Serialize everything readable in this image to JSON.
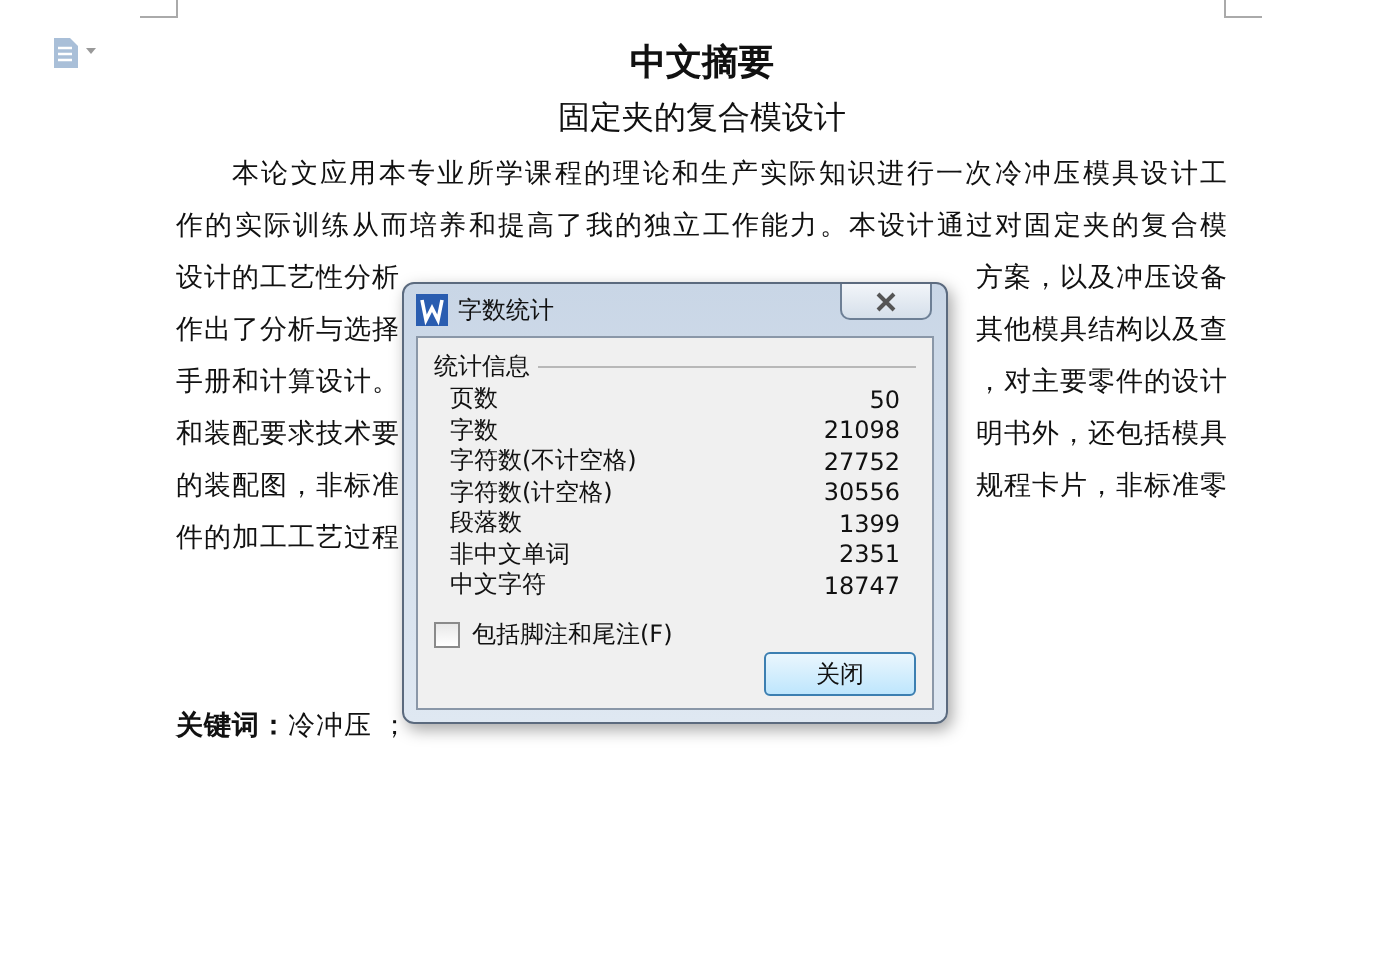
{
  "page": {
    "title": "中文摘要",
    "subtitle": "固定夹的复合模设计",
    "lines": [
      {
        "left": "本论文应用本专业所学课程的理论和生产实际知识进行一次冷冲压模具设计工",
        "indent": true
      },
      {
        "left": "作的实际训练从而培养和提高了我的独立工作能力。本设计通过对固定夹的复合模",
        "indent": false
      },
      {
        "left": "设计的工艺性分析",
        "right": "方案，以及冲压设备",
        "indent": false
      },
      {
        "left": "作出了分析与选择",
        "right": "其他模具结构以及查",
        "indent": false
      },
      {
        "left": "手册和计算设计。",
        "right": "，对主要零件的设计",
        "indent": false
      },
      {
        "left": "和装配要求技术要",
        "right": "明书外，还包括模具",
        "indent": false
      },
      {
        "left": "的装配图，非标准",
        "right": "规程卡片，非标准零",
        "indent": false
      },
      {
        "left": "件的加工工艺过程",
        "indent": false
      }
    ],
    "keywords": {
      "label": "关键词：",
      "text": "冷冲压 ；"
    }
  },
  "dialog": {
    "title": "字数统计",
    "group": "统计信息",
    "stats": [
      {
        "label": "页数",
        "value": "50"
      },
      {
        "label": "字数",
        "value": "21098"
      },
      {
        "label": "字符数(不计空格)",
        "value": "27752"
      },
      {
        "label": "字符数(计空格)",
        "value": "30556"
      },
      {
        "label": "段落数",
        "value": "1399"
      },
      {
        "label": "非中文单词",
        "value": "2351"
      },
      {
        "label": "中文字符",
        "value": "18747"
      }
    ],
    "checkbox": {
      "label": "包括脚注和尾注(F)",
      "checked": false
    },
    "buttons": [
      "关闭"
    ]
  }
}
